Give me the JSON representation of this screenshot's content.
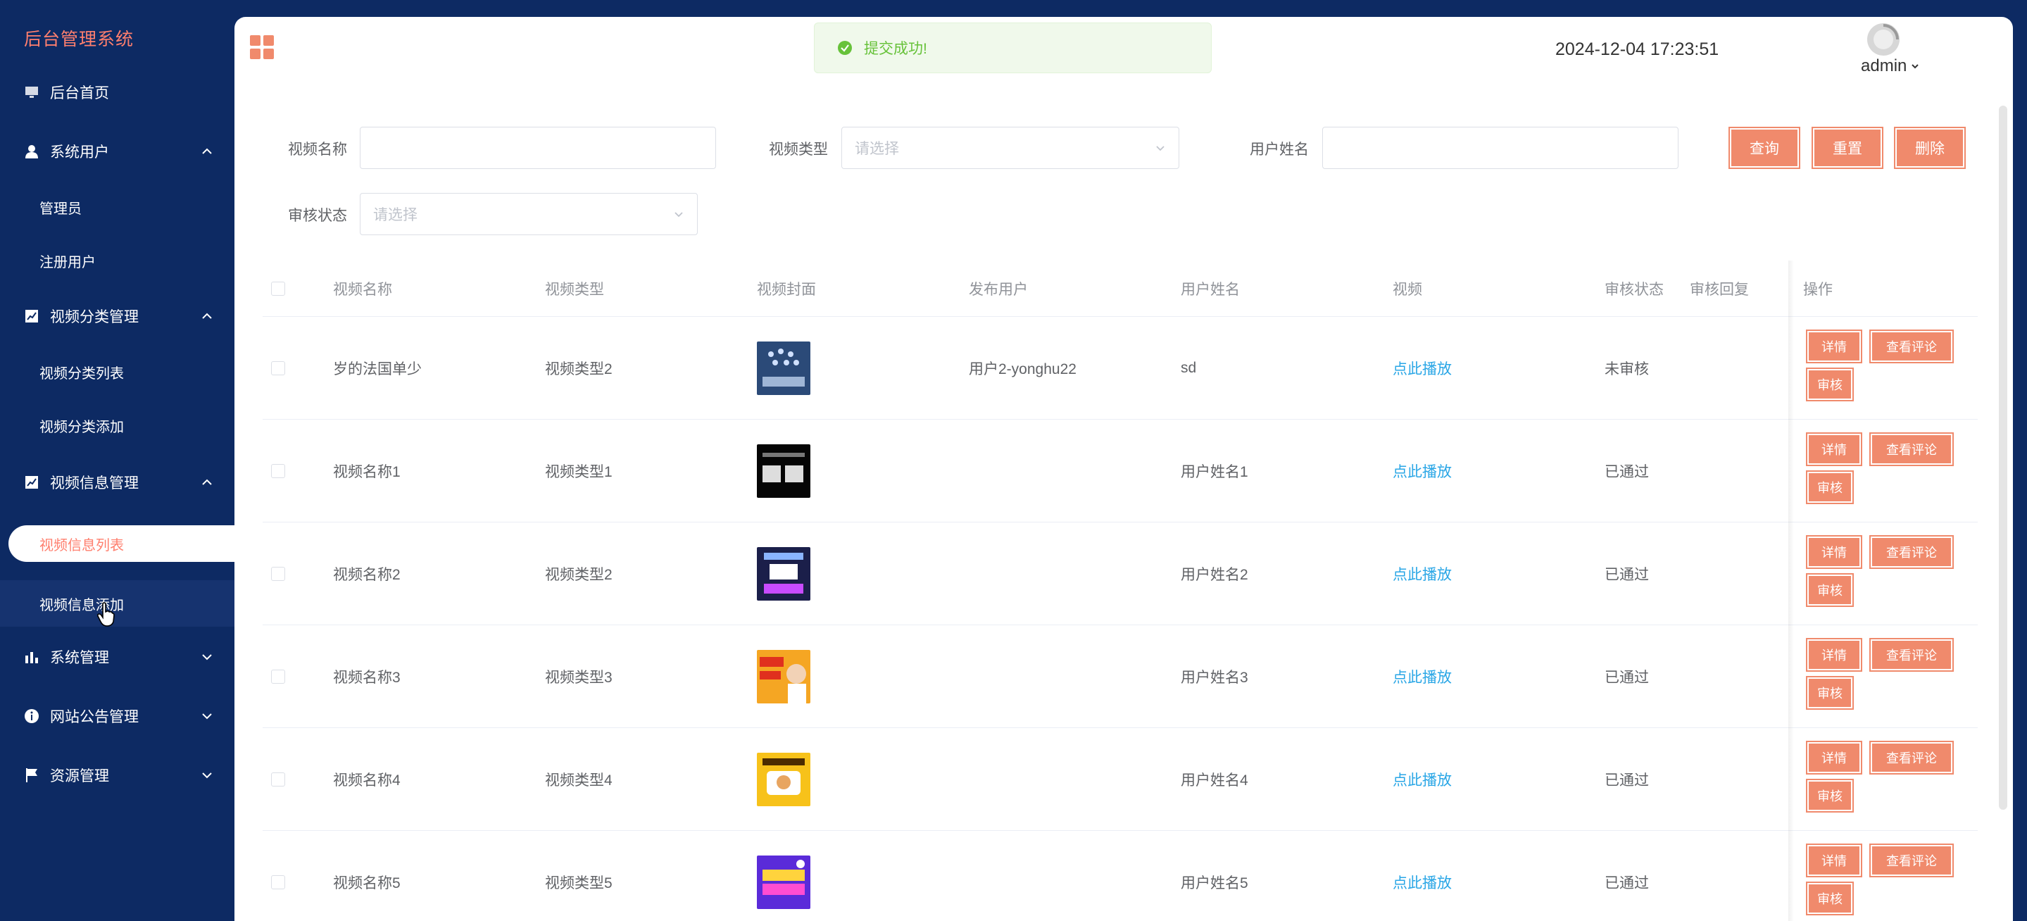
{
  "app": {
    "brand": "后台管理系统"
  },
  "colors": {
    "sidebar_bg": "#0d2a63",
    "accent": "#f08a6c",
    "brand_text": "#ff7f6e",
    "link": "#29a6e6",
    "success": "#67c23a"
  },
  "sidebar": {
    "items": [
      {
        "label": "后台首页",
        "icon": "monitor-icon"
      },
      {
        "label": "系统用户",
        "icon": "user-icon",
        "expanded": true,
        "children": [
          "管理员",
          "注册用户"
        ]
      },
      {
        "label": "视频分类管理",
        "icon": "chart-line-icon",
        "expanded": true,
        "children": [
          "视频分类列表",
          "视频分类添加"
        ]
      },
      {
        "label": "视频信息管理",
        "icon": "chart-line-icon",
        "expanded": true,
        "children": [
          "视频信息列表",
          "视频信息添加"
        ]
      },
      {
        "label": "系统管理",
        "icon": "bar-chart-icon",
        "expanded": false
      },
      {
        "label": "网站公告管理",
        "icon": "info-icon",
        "expanded": false
      },
      {
        "label": "资源管理",
        "icon": "flag-icon",
        "expanded": false
      }
    ],
    "active_sub": "视频信息列表",
    "hovered_sub": "视频信息添加"
  },
  "header": {
    "toast": "提交成功!",
    "datetime": "2024-12-04 17:23:51",
    "user": "admin"
  },
  "search": {
    "video_name_label": "视频名称",
    "video_type_label": "视频类型",
    "video_type_placeholder": "请选择",
    "user_name_label": "用户姓名",
    "audit_status_label": "审核状态",
    "audit_status_placeholder": "请选择",
    "query_btn": "查询",
    "reset_btn": "重置",
    "delete_btn": "删除"
  },
  "table": {
    "headers": [
      "视频名称",
      "视频类型",
      "视频封面",
      "发布用户",
      "用户姓名",
      "视频",
      "审核状态",
      "审核回复",
      "操作"
    ],
    "rows": [
      {
        "name": "岁的法国单少",
        "type": "视频类型2",
        "cover": "cover-1",
        "publisher": "用户2-yonghu22",
        "user": "sd",
        "video": "点此播放",
        "status": "未审核",
        "reply": ""
      },
      {
        "name": "视频名称1",
        "type": "视频类型1",
        "cover": "cover-2",
        "publisher": "",
        "user": "用户姓名1",
        "video": "点此播放",
        "status": "已通过",
        "reply": ""
      },
      {
        "name": "视频名称2",
        "type": "视频类型2",
        "cover": "cover-3",
        "publisher": "",
        "user": "用户姓名2",
        "video": "点此播放",
        "status": "已通过",
        "reply": ""
      },
      {
        "name": "视频名称3",
        "type": "视频类型3",
        "cover": "cover-4",
        "publisher": "",
        "user": "用户姓名3",
        "video": "点此播放",
        "status": "已通过",
        "reply": ""
      },
      {
        "name": "视频名称4",
        "type": "视频类型4",
        "cover": "cover-5",
        "publisher": "",
        "user": "用户姓名4",
        "video": "点此播放",
        "status": "已通过",
        "reply": ""
      },
      {
        "name": "视频名称5",
        "type": "视频类型5",
        "cover": "cover-6",
        "publisher": "",
        "user": "用户姓名5",
        "video": "点此播放",
        "status": "已通过",
        "reply": ""
      }
    ],
    "ops": {
      "detail": "详情",
      "comments": "查看评论",
      "audit": "审核"
    }
  }
}
